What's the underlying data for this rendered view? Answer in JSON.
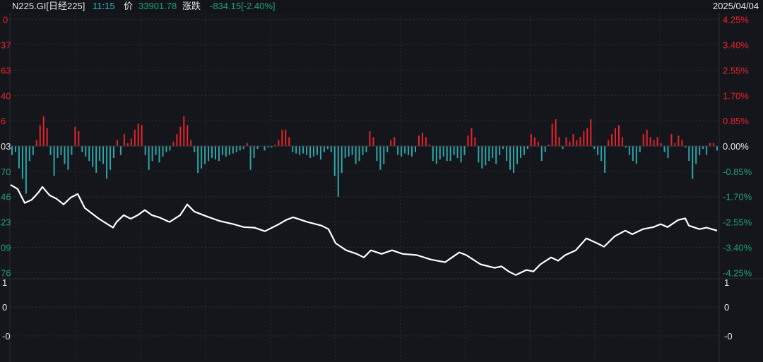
{
  "header": {
    "symbol": "N225.GI[日经225]",
    "time": "11:15",
    "price_label": "价",
    "price": "33901.78",
    "change_label": "涨跌",
    "change": "-834.15[-2.40%]",
    "date": "2025/04/04"
  },
  "colors": {
    "background": "#15161b",
    "up": "#e8232c",
    "down": "#1fa272",
    "bar_down": "#2aa6a9",
    "line": "#ffffff",
    "time": "#2bb8c4"
  },
  "chart_data": {
    "type": "line",
    "title": "N225.GI[日经225] intraday",
    "ylim_pct": [
      -4.25,
      4.25
    ],
    "grid": true,
    "right_ticks": [
      {
        "pct": 4.25,
        "label": "4.25%"
      },
      {
        "pct": 3.4,
        "label": "3.40%"
      },
      {
        "pct": 2.55,
        "label": "2.55%"
      },
      {
        "pct": 1.7,
        "label": "1.70%"
      },
      {
        "pct": 0.85,
        "label": "0.85%"
      },
      {
        "pct": 0,
        "label": "0.00%"
      },
      {
        "pct": -0.85,
        "label": "-0.85%"
      },
      {
        "pct": -1.7,
        "label": "-1.70%"
      },
      {
        "pct": -2.55,
        "label": "-2.55%"
      },
      {
        "pct": -3.4,
        "label": "-3.40%"
      },
      {
        "pct": -4.25,
        "label": "-4.25%"
      }
    ],
    "left_ticks": [
      "0",
      "37",
      "63",
      "40",
      "6",
      "03",
      "70",
      "46",
      "23",
      "09",
      "76"
    ],
    "lower_panel_ticks_left": [
      "1",
      "0",
      "-0"
    ],
    "lower_panel_ticks_right": [
      "1",
      "0",
      "-0"
    ],
    "price_series_pct": [
      [
        0,
        -1.3
      ],
      [
        2,
        -1.44
      ],
      [
        4,
        -1.91
      ],
      [
        6,
        -1.8
      ],
      [
        8,
        -1.54
      ],
      [
        9,
        -1.37
      ],
      [
        11,
        -1.65
      ],
      [
        13,
        -1.77
      ],
      [
        15,
        -1.96
      ],
      [
        17,
        -1.73
      ],
      [
        19,
        -1.61
      ],
      [
        21,
        -2.08
      ],
      [
        25,
        -2.44
      ],
      [
        29,
        -2.74
      ],
      [
        30,
        -2.55
      ],
      [
        32,
        -2.32
      ],
      [
        34,
        -2.44
      ],
      [
        36,
        -2.32
      ],
      [
        38,
        -2.15
      ],
      [
        40,
        -2.32
      ],
      [
        42,
        -2.39
      ],
      [
        45,
        -2.55
      ],
      [
        48,
        -2.32
      ],
      [
        50,
        -1.96
      ],
      [
        52,
        -2.2
      ],
      [
        55,
        -2.34
      ],
      [
        59,
        -2.51
      ],
      [
        63,
        -2.62
      ],
      [
        66,
        -2.72
      ],
      [
        69,
        -2.74
      ],
      [
        72,
        -2.86
      ],
      [
        74,
        -2.74
      ],
      [
        76,
        -2.62
      ],
      [
        78,
        -2.48
      ],
      [
        80,
        -2.39
      ],
      [
        84,
        -2.55
      ],
      [
        88,
        -2.67
      ],
      [
        90,
        -2.79
      ],
      [
        92,
        -3.26
      ],
      [
        95,
        -3.5
      ],
      [
        98,
        -3.62
      ],
      [
        100,
        -3.74
      ],
      [
        102,
        -3.5
      ],
      [
        105,
        -3.62
      ],
      [
        108,
        -3.5
      ],
      [
        111,
        -3.62
      ],
      [
        115,
        -3.66
      ],
      [
        119,
        -3.81
      ],
      [
        123,
        -3.9
      ],
      [
        127,
        -3.57
      ],
      [
        129,
        -3.66
      ],
      [
        133,
        -3.97
      ],
      [
        137,
        -4.09
      ],
      [
        139,
        -4.04
      ],
      [
        141,
        -4.21
      ],
      [
        143,
        -4.33
      ],
      [
        146,
        -4.16
      ],
      [
        148,
        -4.21
      ],
      [
        150,
        -3.97
      ],
      [
        153,
        -3.74
      ],
      [
        155,
        -3.85
      ],
      [
        157,
        -3.66
      ],
      [
        160,
        -3.5
      ],
      [
        163,
        -3.1
      ],
      [
        166,
        -3.26
      ],
      [
        168,
        -3.38
      ],
      [
        171,
        -3.03
      ],
      [
        174,
        -2.84
      ],
      [
        176,
        -2.96
      ],
      [
        179,
        -2.79
      ],
      [
        182,
        -2.72
      ],
      [
        184,
        -2.62
      ],
      [
        186,
        -2.72
      ],
      [
        189,
        -2.48
      ],
      [
        191,
        -2.43
      ],
      [
        192,
        -2.67
      ],
      [
        195,
        -2.79
      ],
      [
        197,
        -2.74
      ],
      [
        200,
        -2.84
      ]
    ],
    "change_bars_pct": [
      -0.3,
      -0.2,
      -0.75,
      -1.1,
      -1.6,
      -0.5,
      -0.3,
      0.2,
      0.7,
      1.0,
      0.6,
      -0.3,
      -1.0,
      -0.4,
      -0.3,
      -0.6,
      -0.8,
      -0.3,
      0.65,
      0.5,
      -0.2,
      -0.35,
      -0.5,
      -0.7,
      -0.9,
      -0.5,
      -0.6,
      -1.1,
      -0.8,
      -0.4,
      0.2,
      -0.3,
      0.4,
      0.1,
      0.25,
      0.55,
      0.75,
      0.7,
      -0.3,
      -0.8,
      -0.5,
      -0.3,
      -0.55,
      -0.35,
      -0.2,
      -0.15,
      0.15,
      0.4,
      0.65,
      1.0,
      0.7,
      0.2,
      -0.2,
      -0.9,
      -0.75,
      -0.6,
      -0.5,
      -0.4,
      -0.45,
      -0.5,
      -0.3,
      -0.35,
      -0.3,
      -0.25,
      -0.2,
      -0.15,
      -0.1,
      0.1,
      -0.8,
      -0.4,
      -0.1,
      0.0,
      -0.15,
      -0.05,
      -0.05,
      0.05,
      0.2,
      0.55,
      0.55,
      0.3,
      -0.2,
      -0.25,
      -0.3,
      -0.25,
      -0.3,
      -0.4,
      -0.35,
      -0.3,
      -0.45,
      -0.2,
      -0.1,
      -0.2,
      -1.0,
      -1.7,
      -0.9,
      -0.4,
      -0.35,
      -0.3,
      -0.6,
      -0.5,
      -0.3,
      -0.2,
      0.5,
      0.3,
      -0.5,
      -0.8,
      -0.6,
      -0.2,
      0.2,
      0.3,
      -0.3,
      -0.35,
      -0.25,
      -0.3,
      -0.35,
      -0.2,
      0.35,
      0.45,
      0.3,
      0.05,
      -0.5,
      -0.6,
      -0.45,
      -0.35,
      -0.5,
      -0.5,
      -0.3,
      -0.4,
      -0.55,
      -0.3,
      0.35,
      0.6,
      0.3,
      -0.55,
      -0.75,
      -0.65,
      -0.5,
      -0.4,
      -0.6,
      -0.3,
      -0.1,
      -0.5,
      -0.8,
      -0.9,
      -0.6,
      -0.4,
      -0.3,
      -0.1,
      0.4,
      0.3,
      0.15,
      -0.5,
      -0.2,
      0.05,
      0.75,
      0.9,
      0.3,
      -0.1,
      0.3,
      0.15,
      0.4,
      0.2,
      0.3,
      0.5,
      0.6,
      0.9,
      -0.1,
      -0.3,
      -0.5,
      -0.9,
      0.2,
      0.4,
      0.6,
      0.7,
      0.3,
      -0.05,
      -0.3,
      -0.5,
      -0.6,
      -0.2,
      0.4,
      0.55,
      0.3,
      0.2,
      0.3,
      0.1,
      -0.2,
      -0.4,
      0.4,
      0.1,
      0.35,
      0.2,
      -0.05,
      -0.5,
      -1.1,
      -0.6,
      -0.3,
      -0.1,
      -0.3,
      0.1,
      0.1,
      -0.15
    ]
  }
}
